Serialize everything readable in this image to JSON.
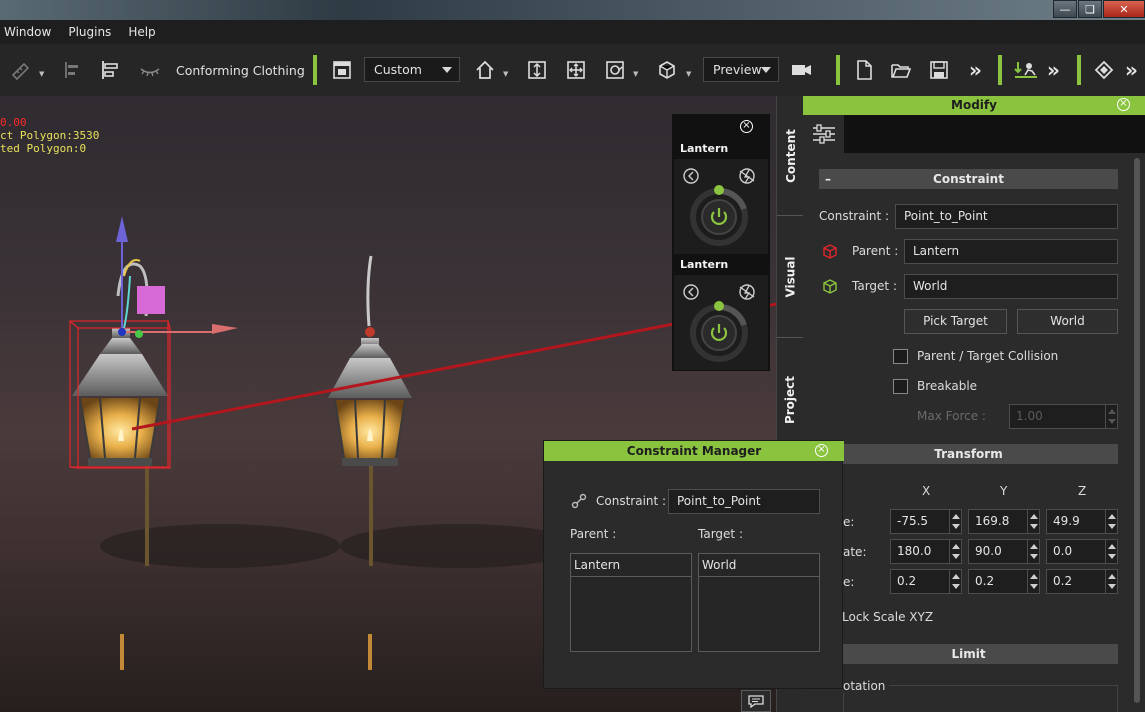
{
  "menu": [
    "Window",
    "Plugins",
    "Help"
  ],
  "toolbar": {
    "conforming_label": "Conforming Clothing",
    "layout_dropdown": "Custom",
    "render_dropdown": "Preview"
  },
  "viewport": {
    "stat_line1": "0.00",
    "stat_line2": "ct Polygon:3530",
    "stat_line3": "ted Polygon:0"
  },
  "motion_panel": {
    "items": [
      {
        "title": "Lantern"
      },
      {
        "title": "Lantern"
      }
    ]
  },
  "side_tabs": [
    "Content",
    "Visual",
    "Project"
  ],
  "modify": {
    "title": "Modify",
    "constraint_section": {
      "title": "Constraint",
      "constraint_label": "Constraint :",
      "constraint_value": "Point_to_Point",
      "parent_label": "Parent :",
      "parent_value": "Lantern",
      "target_label": "Target :",
      "target_value": "World",
      "pick_target_button": "Pick Target",
      "world_button": "World",
      "collision_label": "Parent / Target Collision",
      "breakable_label": "Breakable",
      "max_force_label": "Max Force :",
      "max_force_value": "1.00"
    },
    "transform_section": {
      "title": "Transform",
      "col_x": "X",
      "col_y": "Y",
      "col_z": "Z",
      "rows": [
        {
          "label": "e:",
          "x": "-75.5",
          "y": "169.8",
          "z": "49.9"
        },
        {
          "label": "ate:",
          "x": "180.0",
          "y": "90.0",
          "z": "0.0"
        },
        {
          "label": "e:",
          "x": "0.2",
          "y": "0.2",
          "z": "0.2"
        }
      ],
      "lock_scale_label": "Lock Scale XYZ"
    },
    "limit_section": {
      "title": "Limit",
      "rotation_label": "otation"
    }
  },
  "constraint_manager": {
    "title": "Constraint Manager",
    "constraint_label": "Constraint :",
    "constraint_value": "Point_to_Point",
    "parent_header": "Parent :",
    "target_header": "Target :",
    "parent_item": "Lantern",
    "target_item": "World"
  },
  "colors": {
    "accent_green": "#8ac43f",
    "selection_red": "#e0262b",
    "stat_yellow": "#e8e05a"
  }
}
